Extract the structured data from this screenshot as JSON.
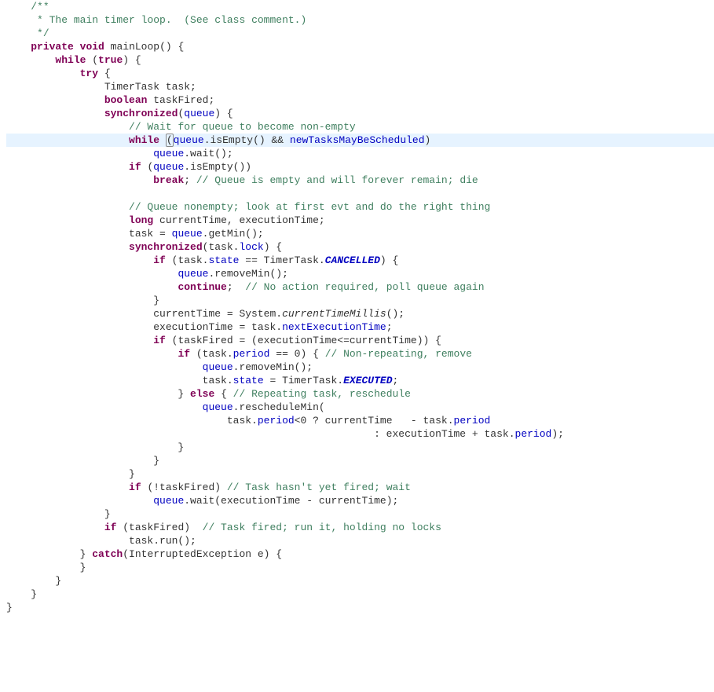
{
  "code": {
    "lang": "java",
    "highlighted_line_index": 11,
    "lines": [
      {
        "indent": 2,
        "tokens": [
          {
            "t": "/**",
            "c": "comment"
          }
        ]
      },
      {
        "indent": 2,
        "tokens": [
          {
            "t": " * The main timer loop.  (See class comment.)",
            "c": "comment"
          }
        ]
      },
      {
        "indent": 2,
        "tokens": [
          {
            "t": " */",
            "c": "comment"
          }
        ]
      },
      {
        "indent": 2,
        "tokens": [
          {
            "t": "private",
            "c": "kw"
          },
          {
            "t": " "
          },
          {
            "t": "void",
            "c": "kw"
          },
          {
            "t": " mainLoop() {"
          }
        ]
      },
      {
        "indent": 4,
        "tokens": [
          {
            "t": "while",
            "c": "kw"
          },
          {
            "t": " ("
          },
          {
            "t": "true",
            "c": "kw"
          },
          {
            "t": ") {"
          }
        ]
      },
      {
        "indent": 6,
        "tokens": [
          {
            "t": "try",
            "c": "kw"
          },
          {
            "t": " {"
          }
        ]
      },
      {
        "indent": 8,
        "tokens": [
          {
            "t": "TimerTask task;"
          }
        ]
      },
      {
        "indent": 8,
        "tokens": [
          {
            "t": "boolean",
            "c": "kw"
          },
          {
            "t": " taskFired;"
          }
        ]
      },
      {
        "indent": 8,
        "tokens": [
          {
            "t": "synchronized",
            "c": "kw"
          },
          {
            "t": "("
          },
          {
            "t": "queue",
            "c": "field"
          },
          {
            "t": ") {"
          }
        ]
      },
      {
        "indent": 10,
        "tokens": [
          {
            "t": "// Wait for queue to become non-empty",
            "c": "comment"
          }
        ]
      },
      {
        "indent": 10,
        "tokens": [
          {
            "t": "while",
            "c": "kw"
          },
          {
            "t": " "
          },
          {
            "t": "(",
            "c": "bracket"
          },
          {
            "t": "queue",
            "c": "field"
          },
          {
            "t": ".isEmpty() && "
          },
          {
            "t": "newTasksMayBeScheduled",
            "c": "field"
          },
          {
            "t": ")"
          }
        ]
      },
      {
        "indent": 12,
        "tokens": [
          {
            "t": "queue",
            "c": "field"
          },
          {
            "t": ".wait();"
          }
        ]
      },
      {
        "indent": 10,
        "tokens": [
          {
            "t": "if",
            "c": "kw"
          },
          {
            "t": " ("
          },
          {
            "t": "queue",
            "c": "field"
          },
          {
            "t": ".isEmpty())"
          }
        ]
      },
      {
        "indent": 12,
        "tokens": [
          {
            "t": "break",
            "c": "kw"
          },
          {
            "t": "; "
          },
          {
            "t": "// Queue is empty and will forever remain; die",
            "c": "comment"
          }
        ]
      },
      {
        "indent": 0,
        "tokens": []
      },
      {
        "indent": 10,
        "tokens": [
          {
            "t": "// Queue nonempty; look at first evt and do the right thing",
            "c": "comment"
          }
        ]
      },
      {
        "indent": 10,
        "tokens": [
          {
            "t": "long",
            "c": "kw"
          },
          {
            "t": " currentTime, executionTime;"
          }
        ]
      },
      {
        "indent": 10,
        "tokens": [
          {
            "t": "task = "
          },
          {
            "t": "queue",
            "c": "field"
          },
          {
            "t": ".getMin();"
          }
        ]
      },
      {
        "indent": 10,
        "tokens": [
          {
            "t": "synchronized",
            "c": "kw"
          },
          {
            "t": "(task."
          },
          {
            "t": "lock",
            "c": "field"
          },
          {
            "t": ") {"
          }
        ]
      },
      {
        "indent": 12,
        "tokens": [
          {
            "t": "if",
            "c": "kw"
          },
          {
            "t": " (task."
          },
          {
            "t": "state",
            "c": "field"
          },
          {
            "t": " == TimerTask."
          },
          {
            "t": "CANCELLED",
            "c": "staticf"
          },
          {
            "t": ") {"
          }
        ]
      },
      {
        "indent": 14,
        "tokens": [
          {
            "t": "queue",
            "c": "field"
          },
          {
            "t": ".removeMin();"
          }
        ]
      },
      {
        "indent": 14,
        "tokens": [
          {
            "t": "continue",
            "c": "kw"
          },
          {
            "t": ";  "
          },
          {
            "t": "// No action required, poll queue again",
            "c": "comment"
          }
        ]
      },
      {
        "indent": 12,
        "tokens": [
          {
            "t": "}"
          }
        ]
      },
      {
        "indent": 12,
        "tokens": [
          {
            "t": "currentTime = System."
          },
          {
            "t": "currentTimeMillis",
            "c": "staticm"
          },
          {
            "t": "();"
          }
        ]
      },
      {
        "indent": 12,
        "tokens": [
          {
            "t": "executionTime = task."
          },
          {
            "t": "nextExecutionTime",
            "c": "field"
          },
          {
            "t": ";"
          }
        ]
      },
      {
        "indent": 12,
        "tokens": [
          {
            "t": "if",
            "c": "kw"
          },
          {
            "t": " (taskFired = (executionTime<=currentTime)) {"
          }
        ]
      },
      {
        "indent": 14,
        "tokens": [
          {
            "t": "if",
            "c": "kw"
          },
          {
            "t": " (task."
          },
          {
            "t": "period",
            "c": "field"
          },
          {
            "t": " == 0) { "
          },
          {
            "t": "// Non-repeating, remove",
            "c": "comment"
          }
        ]
      },
      {
        "indent": 16,
        "tokens": [
          {
            "t": "queue",
            "c": "field"
          },
          {
            "t": ".removeMin();"
          }
        ]
      },
      {
        "indent": 16,
        "tokens": [
          {
            "t": "task."
          },
          {
            "t": "state",
            "c": "field"
          },
          {
            "t": " = TimerTask."
          },
          {
            "t": "EXECUTED",
            "c": "staticf"
          },
          {
            "t": ";"
          }
        ]
      },
      {
        "indent": 14,
        "tokens": [
          {
            "t": "} "
          },
          {
            "t": "else",
            "c": "kw"
          },
          {
            "t": " { "
          },
          {
            "t": "// Repeating task, reschedule",
            "c": "comment"
          }
        ]
      },
      {
        "indent": 16,
        "tokens": [
          {
            "t": "queue",
            "c": "field"
          },
          {
            "t": ".rescheduleMin("
          }
        ]
      },
      {
        "indent": 18,
        "tokens": [
          {
            "t": "task."
          },
          {
            "t": "period",
            "c": "field"
          },
          {
            "t": "<0 ? currentTime   - task."
          },
          {
            "t": "period",
            "c": "field"
          }
        ]
      },
      {
        "indent": 30,
        "tokens": [
          {
            "t": ": executionTime + task."
          },
          {
            "t": "period",
            "c": "field"
          },
          {
            "t": ");"
          }
        ]
      },
      {
        "indent": 14,
        "tokens": [
          {
            "t": "}"
          }
        ]
      },
      {
        "indent": 12,
        "tokens": [
          {
            "t": "}"
          }
        ]
      },
      {
        "indent": 10,
        "tokens": [
          {
            "t": "}"
          }
        ]
      },
      {
        "indent": 10,
        "tokens": [
          {
            "t": "if",
            "c": "kw"
          },
          {
            "t": " (!taskFired) "
          },
          {
            "t": "// Task hasn't yet fired; wait",
            "c": "comment"
          }
        ]
      },
      {
        "indent": 12,
        "tokens": [
          {
            "t": "queue",
            "c": "field"
          },
          {
            "t": ".wait(executionTime - currentTime);"
          }
        ]
      },
      {
        "indent": 8,
        "tokens": [
          {
            "t": "}"
          }
        ]
      },
      {
        "indent": 8,
        "tokens": [
          {
            "t": "if",
            "c": "kw"
          },
          {
            "t": " (taskFired)  "
          },
          {
            "t": "// Task fired; run it, holding no locks",
            "c": "comment"
          }
        ]
      },
      {
        "indent": 10,
        "tokens": [
          {
            "t": "task.run();"
          }
        ]
      },
      {
        "indent": 6,
        "tokens": [
          {
            "t": "} "
          },
          {
            "t": "catch",
            "c": "kw"
          },
          {
            "t": "(InterruptedException e) {"
          }
        ]
      },
      {
        "indent": 6,
        "tokens": [
          {
            "t": "}"
          }
        ]
      },
      {
        "indent": 4,
        "tokens": [
          {
            "t": "}"
          }
        ]
      },
      {
        "indent": 2,
        "tokens": [
          {
            "t": "}"
          }
        ]
      },
      {
        "indent": 0,
        "tokens": [
          {
            "t": "}"
          }
        ]
      }
    ]
  }
}
